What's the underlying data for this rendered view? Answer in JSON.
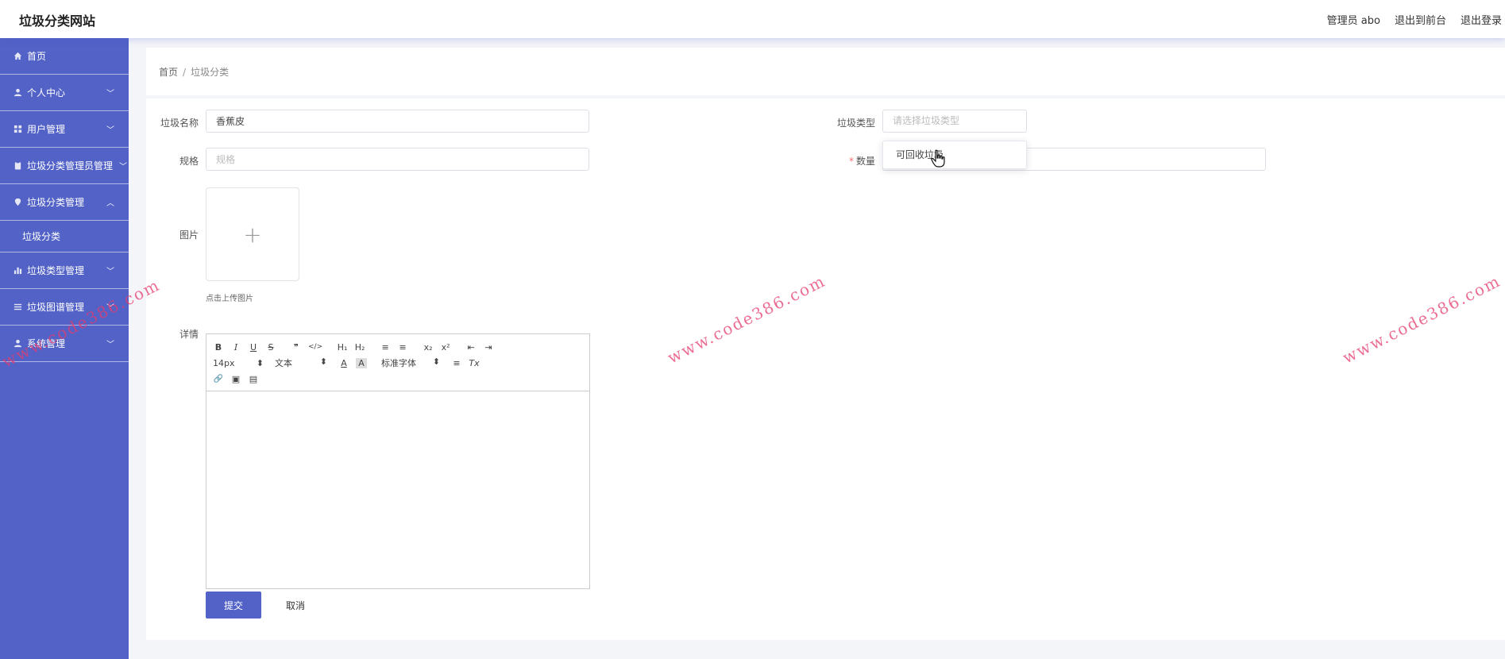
{
  "header": {
    "brand": "垃圾分类网站",
    "admin": "管理员 abo",
    "to_front": "退出到前台",
    "logout": "退出登录"
  },
  "sidebar": {
    "items": [
      {
        "label": "首页",
        "icon": "home-icon"
      },
      {
        "label": "个人中心",
        "icon": "user-icon",
        "chevron": "down"
      },
      {
        "label": "用户管理",
        "icon": "grid-icon",
        "chevron": "down"
      },
      {
        "label": "垃圾分类管理员管理",
        "icon": "clipboard-icon",
        "chevron": "down"
      },
      {
        "label": "垃圾分类管理",
        "icon": "pin-icon",
        "chevron": "up"
      },
      {
        "label": "垃圾类型管理",
        "icon": "chart-icon",
        "chevron": "down"
      },
      {
        "label": "垃圾图谱管理",
        "icon": "list-icon",
        "chevron": "down"
      },
      {
        "label": "系统管理",
        "icon": "user-icon",
        "chevron": "down"
      }
    ],
    "sub_item": "垃圾分类"
  },
  "breadcrumb": {
    "home": "首页",
    "separator": "/",
    "current": "垃圾分类"
  },
  "form": {
    "name_label": "垃圾名称",
    "name_value": "香蕉皮",
    "type_label": "垃圾类型",
    "type_placeholder": "请选择垃圾类型",
    "type_options": [
      "可回收垃圾"
    ],
    "spec_label": "规格",
    "spec_placeholder": "规格",
    "qty_required": "*",
    "qty_label": "数量",
    "image_label": "图片",
    "upload_plus": "+",
    "upload_hint": "点击上传图片",
    "detail_label": "详情",
    "submit": "提交",
    "cancel": "取消"
  },
  "editor": {
    "font_size": "14px",
    "heading": "文本",
    "font_family": "标准字体",
    "buttons": {
      "bold": "B",
      "italic": "I",
      "underline": "U",
      "strike": "S",
      "quote": "❞",
      "code": "</>",
      "h1": "H₁",
      "h2": "H₂",
      "ol": "≡",
      "ul": "≡",
      "sub": "x₂",
      "sup": "x²",
      "indent_l": "⇤",
      "indent_r": "⇥",
      "color": "A",
      "bg": "A",
      "align": "≡",
      "clean": "Tx",
      "link": "🔗",
      "image": "▣",
      "video": "▤"
    }
  },
  "watermark": {
    "text": "www.code386.com",
    "color": "#e63c6e"
  }
}
